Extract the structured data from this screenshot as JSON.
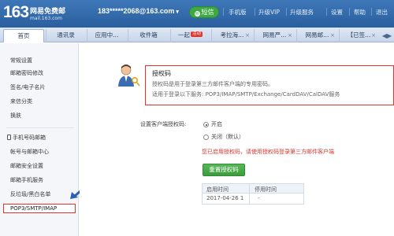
{
  "header": {
    "logo_number": "163",
    "logo_title": "网易免费邮",
    "logo_domain": "mail.163.com",
    "account": "183*****2068@163.com",
    "sms_button": "短信",
    "links": [
      "手机版",
      "升级VIP",
      "升级服务",
      "设置",
      "帮助",
      "退出"
    ]
  },
  "tabs": [
    {
      "label": "首页"
    },
    {
      "label": "通讯录"
    },
    {
      "label": "应用中..."
    },
    {
      "label": "收件箱"
    },
    {
      "label": "一起",
      "badge": "活动"
    },
    {
      "label": "考拉海..."
    },
    {
      "label": "网易严..."
    },
    {
      "label": "网易邮..."
    },
    {
      "label": "【已签..."
    }
  ],
  "tab_arrows": "◀▶",
  "sidebar": {
    "items": [
      "常规设置",
      "邮箱密码修改",
      "签名/电子名片",
      "来信分类",
      "换肤"
    ],
    "items2": [
      "手机号码邮箱",
      "帐号与邮箱中心",
      "邮箱安全设置",
      "邮箱手机服务",
      "反垃圾/黑白名单"
    ],
    "highlighted": "POP3/SMTP/IMAP"
  },
  "auth_box": {
    "title": "授权码",
    "line1": "授权码是用于登录第三方邮件客户端的专用密码。",
    "line2": "适用于登录以下服务: POP3/IMAP/SMTP/Exchange/CardDAV/CalDAV服务"
  },
  "settings": {
    "label": "设置客户端授权码:",
    "option_on": "开启",
    "option_off": "关闭（默认）",
    "warning": "您已启用授权码，请使用授权码登录第三方邮件客户端",
    "reset_button": "重置授权码"
  },
  "table": {
    "headers": [
      "启用时间",
      "停用时间"
    ],
    "rows": [
      [
        "2017-04-26 1",
        "-"
      ]
    ]
  },
  "colors": {
    "header_blue": "#2a5f9f",
    "highlight_red": "#e0352b",
    "button_green": "#3c9c3c"
  }
}
